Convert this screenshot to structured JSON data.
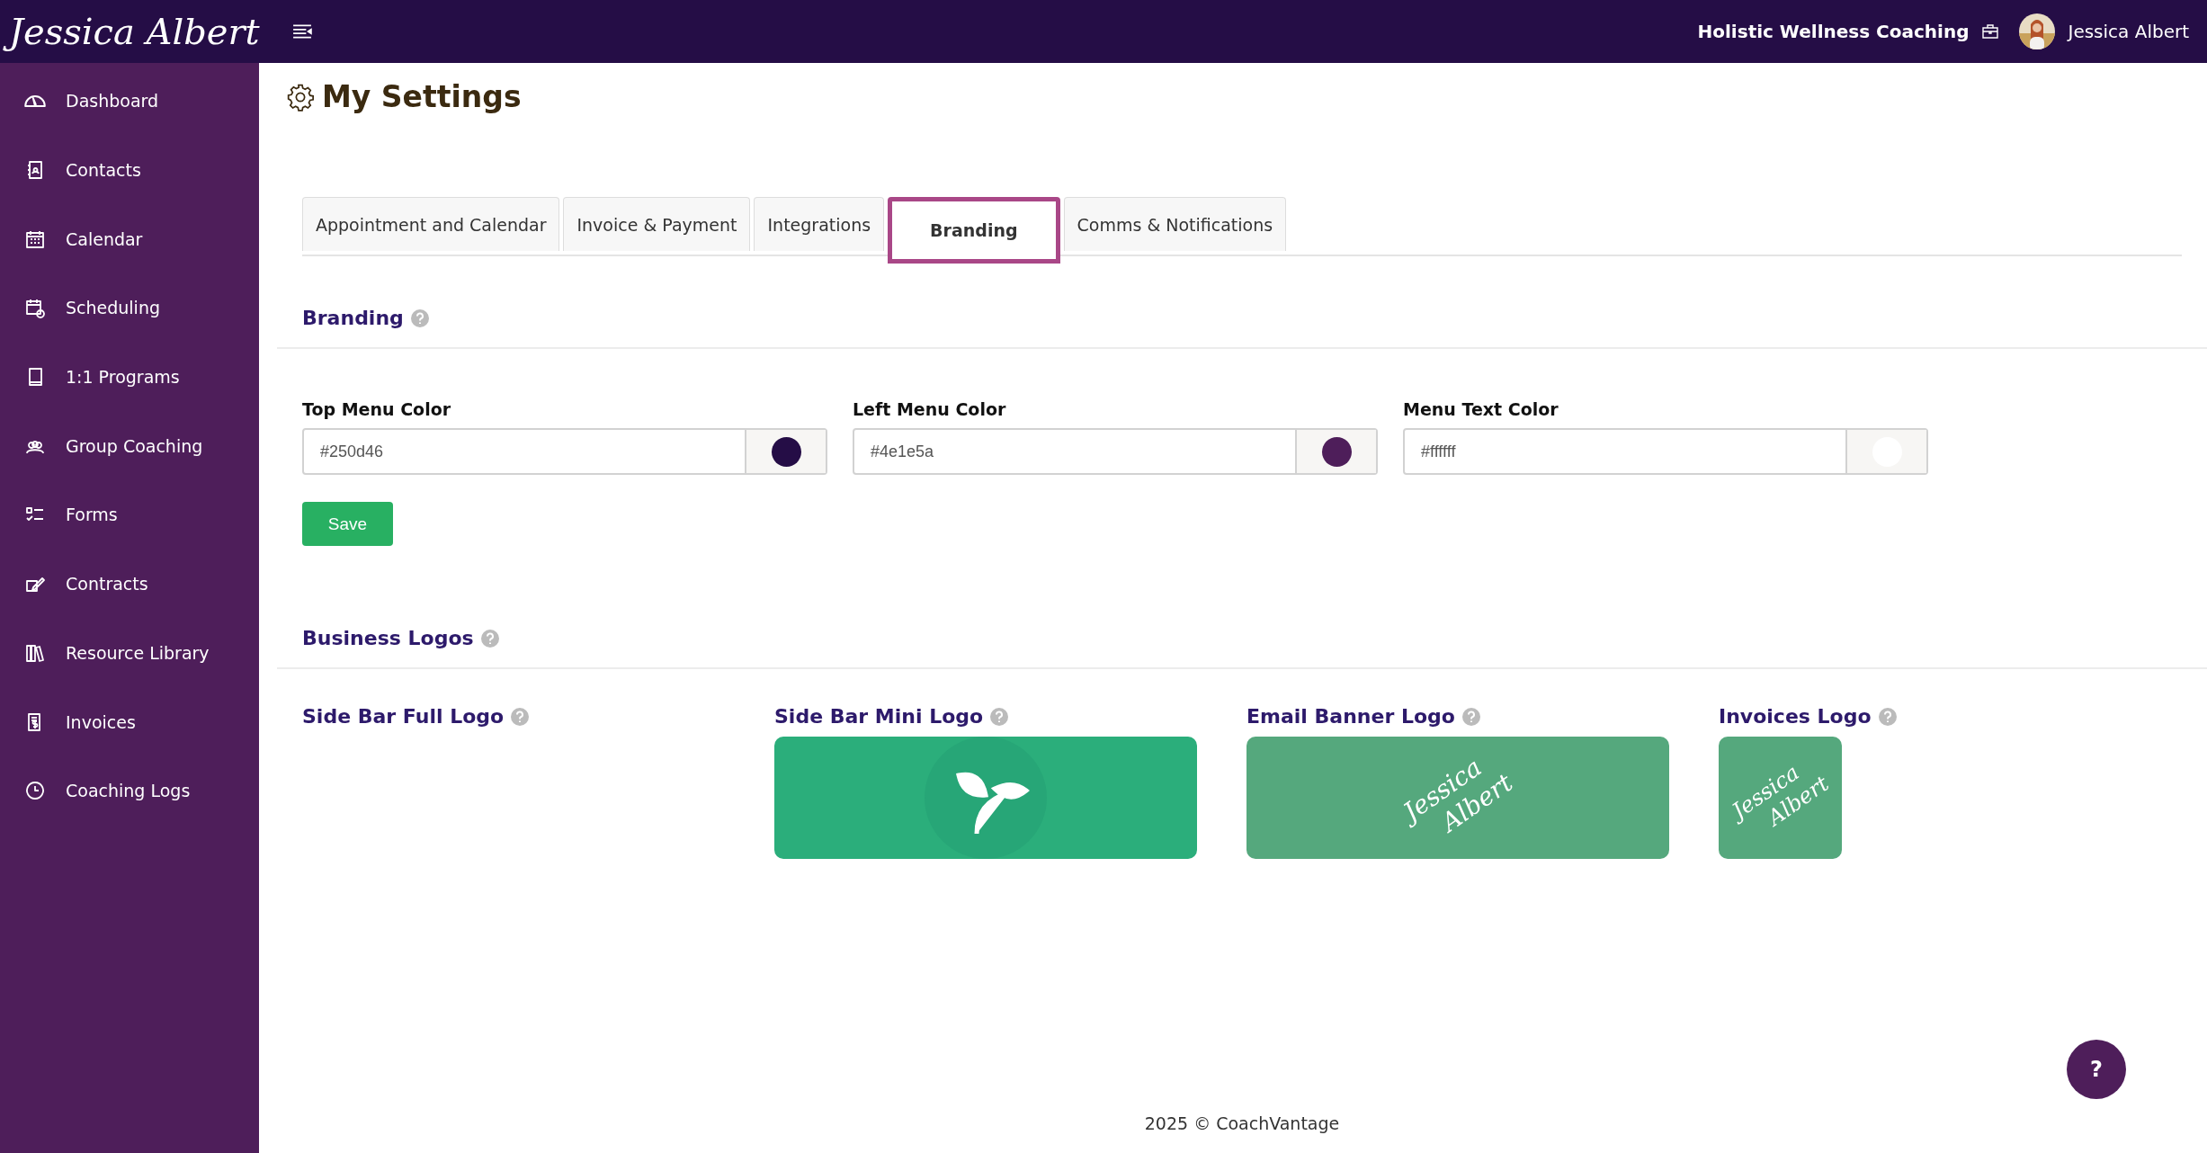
{
  "top_bar": {
    "logo": "Jessica Albert",
    "business": "Holistic Wellness Coaching",
    "user": "Jessica Albert"
  },
  "sidebar": {
    "items": [
      {
        "label": "Dashboard"
      },
      {
        "label": "Contacts"
      },
      {
        "label": "Calendar"
      },
      {
        "label": "Scheduling"
      },
      {
        "label": "1:1 Programs"
      },
      {
        "label": "Group Coaching"
      },
      {
        "label": "Forms"
      },
      {
        "label": "Contracts"
      },
      {
        "label": "Resource Library"
      },
      {
        "label": "Invoices"
      },
      {
        "label": "Coaching Logs"
      }
    ]
  },
  "page_title": "My Settings",
  "tabs": [
    {
      "label": "Appointment and Calendar",
      "selected": false
    },
    {
      "label": "Invoice & Payment",
      "selected": false
    },
    {
      "label": "Integrations",
      "selected": false
    },
    {
      "label": "Branding",
      "selected": true
    },
    {
      "label": "Comms & Notifications",
      "selected": false
    }
  ],
  "branding": {
    "heading": "Branding",
    "fields": [
      {
        "label": "Top Menu Color",
        "value": "#250d46",
        "color": "#250d46"
      },
      {
        "label": "Left Menu Color",
        "value": "#4e1e5a",
        "color": "#4e1e5a"
      },
      {
        "label": "Menu Text Color",
        "value": "#ffffff",
        "color": "#ffffff"
      }
    ],
    "save": "Save"
  },
  "business_logos": {
    "heading": "Business Logos",
    "logos": [
      {
        "label": "Side Bar Full Logo",
        "kind": "empty"
      },
      {
        "label": "Side Bar Mini Logo",
        "kind": "leaf"
      },
      {
        "label": "Email Banner Logo",
        "kind": "script",
        "text": [
          "Jessica",
          "Albert"
        ]
      },
      {
        "label": "Invoices Logo",
        "kind": "script-small",
        "text": [
          "Jessica",
          "Albert"
        ]
      }
    ]
  },
  "footer": "2025 © CoachVantage",
  "help_button": "?"
}
